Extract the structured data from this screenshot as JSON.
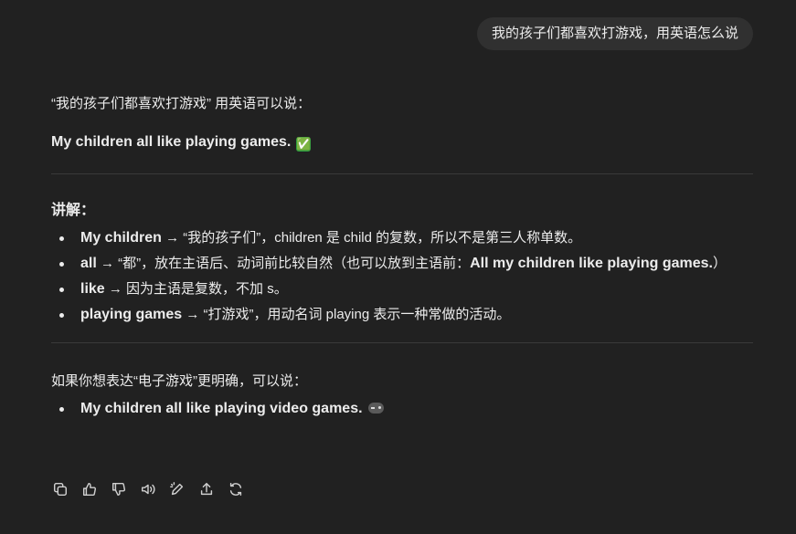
{
  "user_message": "我的孩子们都喜欢打游戏，用英语怎么说",
  "assistant": {
    "intro": "“我的孩子们都喜欢打游戏” 用英语可以说：",
    "main_answer": "My children all like playing games.",
    "main_answer_emoji": "✅",
    "explain_heading": "讲解：",
    "explanations": [
      {
        "term": "My children",
        "text": " → “我的孩子们”，children 是 child 的复数，所以不是第三人称单数。"
      },
      {
        "term": "all",
        "text": " → “都”，放在主语后、动词前比较自然（也可以放到主语前：",
        "bold_tail": "All my children like playing games.",
        "text_end": "）"
      },
      {
        "term": "like",
        "text": " → 因为主语是复数，不加 s。"
      },
      {
        "term": "playing games",
        "text": " → “打游戏”，用动名词 playing 表示一种常做的活动。"
      }
    ],
    "followup_intro": "如果你想表达“电子游戏”更明确，可以说：",
    "followup_answer": "My children all like playing video games.",
    "followup_emoji_icon": "video-game-controller-icon"
  },
  "actions": [
    {
      "name": "copy",
      "icon": "copy-icon"
    },
    {
      "name": "good-response",
      "icon": "thumbs-up-icon"
    },
    {
      "name": "bad-response",
      "icon": "thumbs-down-icon"
    },
    {
      "name": "read-aloud",
      "icon": "speaker-icon"
    },
    {
      "name": "edit-in-canvas",
      "icon": "pencil-sparkle-icon"
    },
    {
      "name": "share",
      "icon": "share-icon"
    },
    {
      "name": "regenerate",
      "icon": "refresh-icon"
    }
  ]
}
